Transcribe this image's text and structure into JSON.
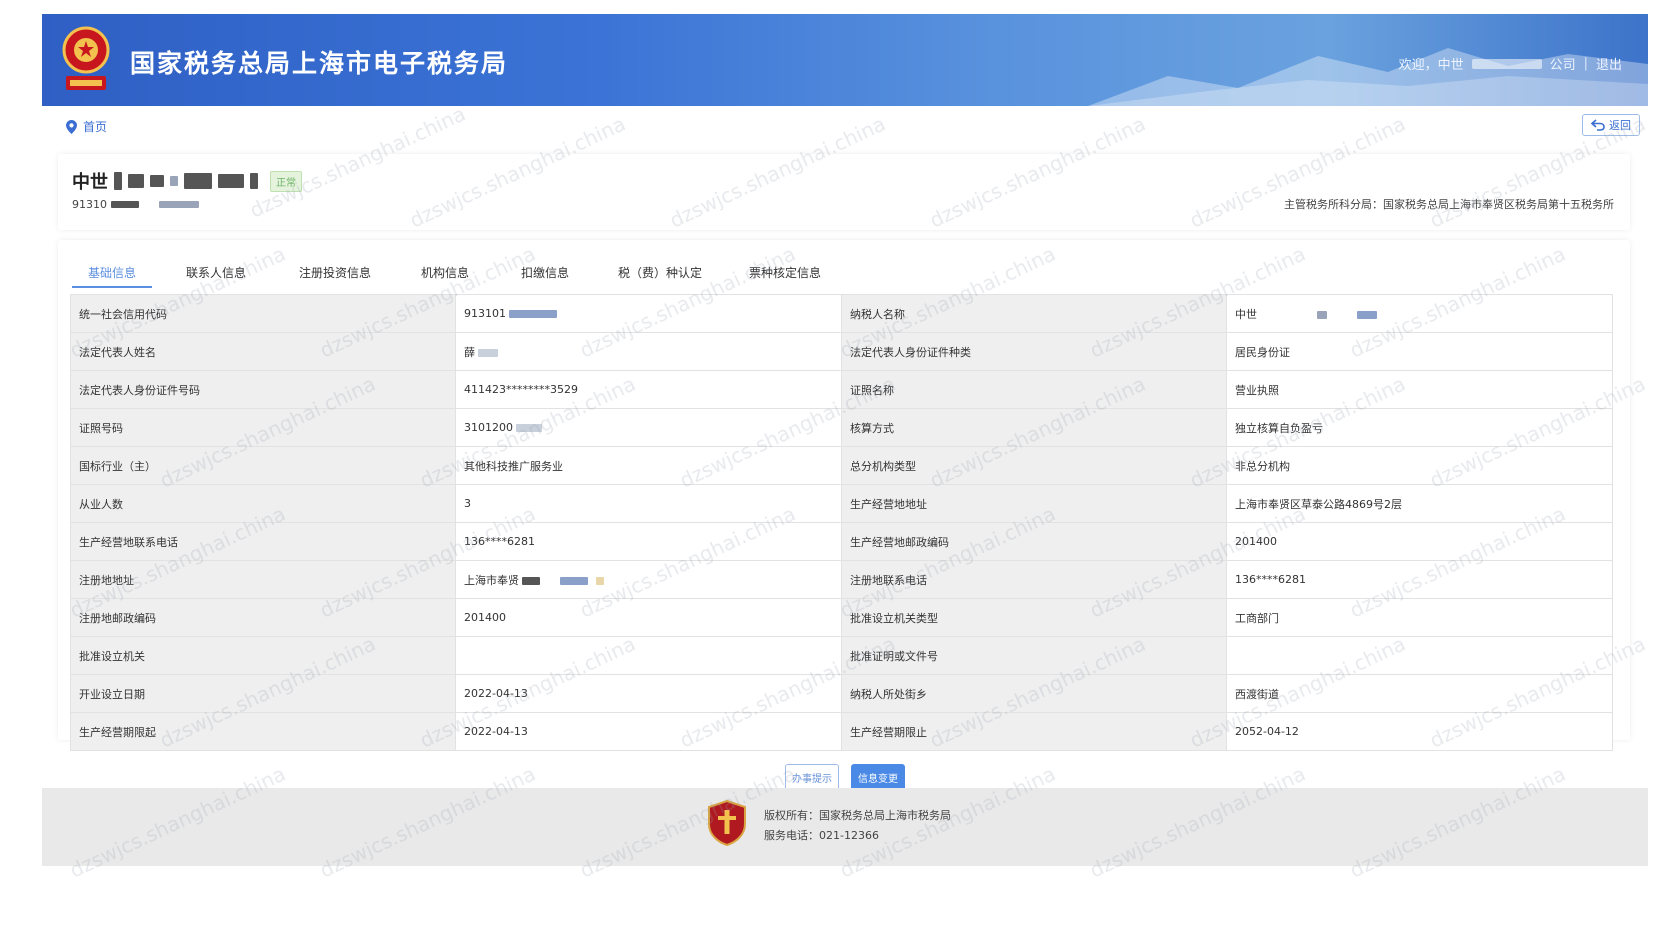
{
  "header": {
    "site_title": "国家税务总局上海市电子税务局",
    "welcome": "欢迎，中世",
    "company_suffix": "公司",
    "separator": "|",
    "logout": "退出"
  },
  "breadcrumb": {
    "home": "首页"
  },
  "back_button": "返回",
  "company": {
    "name_prefix": "中世",
    "status": "正常",
    "code_prefix": "91310",
    "tax_office_label": "主管税务所科分局：",
    "tax_office_value": "国家税务总局上海市奉贤区税务局第十五税务所"
  },
  "tabs": [
    "基础信息",
    "联系人信息",
    "注册投资信息",
    "机构信息",
    "扣缴信息",
    "税（费）种认定",
    "票种核定信息"
  ],
  "active_tab": 0,
  "info_rows": [
    {
      "l1": "统一社会信用代码",
      "v1": "913101",
      "l2": "纳税人名称",
      "v2": "中世"
    },
    {
      "l1": "法定代表人姓名",
      "v1": "薛",
      "l2": "法定代表人身份证件种类",
      "v2": "居民身份证"
    },
    {
      "l1": "法定代表人身份证件号码",
      "v1": "411423********3529",
      "l2": "证照名称",
      "v2": "营业执照"
    },
    {
      "l1": "证照号码",
      "v1": "3101200",
      "l2": "核算方式",
      "v2": "独立核算自负盈亏"
    },
    {
      "l1": "国标行业（主）",
      "v1": "其他科技推广服务业",
      "l2": "总分机构类型",
      "v2": "非总分机构"
    },
    {
      "l1": "从业人数",
      "v1": "3",
      "l2": "生产经营地地址",
      "v2": "上海市奉贤区草泰公路4869号2层"
    },
    {
      "l1": "生产经营地联系电话",
      "v1": "136****6281",
      "l2": "生产经营地邮政编码",
      "v2": "201400"
    },
    {
      "l1": "注册地地址",
      "v1": "上海市奉贤",
      "l2": "注册地联系电话",
      "v2": "136****6281"
    },
    {
      "l1": "注册地邮政编码",
      "v1": "201400",
      "l2": "批准设立机关类型",
      "v2": "工商部门"
    },
    {
      "l1": "批准设立机关",
      "v1": "",
      "l2": "批准证明或文件号",
      "v2": ""
    },
    {
      "l1": "开业设立日期",
      "v1": "2022-04-13",
      "l2": "纳税人所处街乡",
      "v2": "西渡街道"
    },
    {
      "l1": "生产经营期限起",
      "v1": "2022-04-13",
      "l2": "生产经营期限止",
      "v2": "2052-04-12"
    }
  ],
  "buttons": {
    "secondary": "办事提示",
    "primary": "信息变更"
  },
  "footer": {
    "copyright_label": "版权所有：",
    "copyright_value": "国家税务总局上海市税务局",
    "phone_label": "服务电话：",
    "phone_value": "021-12366"
  },
  "watermark_text": "dzswjcs.shanghai.china",
  "colors": {
    "header_blue": "#3b74d6",
    "accent": "#4a8ae6",
    "label_bg": "#efefef"
  },
  "icons": [
    "emblem-icon",
    "location-pin-icon",
    "back-arrow-icon",
    "footer-logo-icon"
  ]
}
